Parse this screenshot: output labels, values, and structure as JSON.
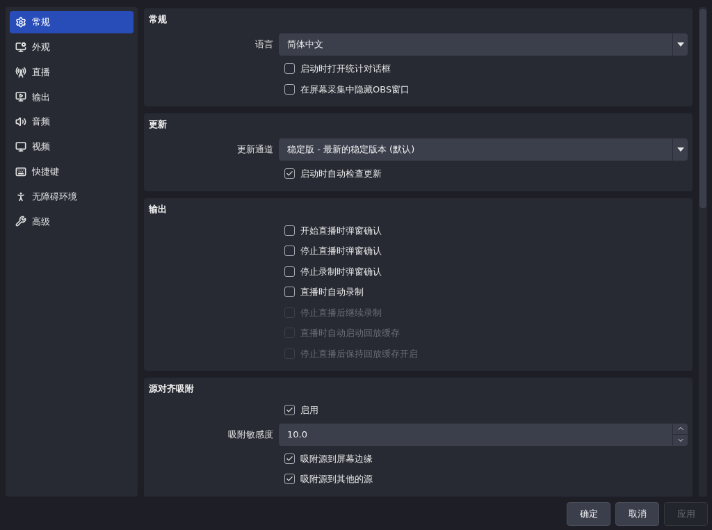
{
  "sidebar": {
    "items": [
      {
        "label": "常规",
        "selected": true
      },
      {
        "label": "外观",
        "selected": false
      },
      {
        "label": "直播",
        "selected": false
      },
      {
        "label": "输出",
        "selected": false
      },
      {
        "label": "音频",
        "selected": false
      },
      {
        "label": "视频",
        "selected": false
      },
      {
        "label": "快捷键",
        "selected": false
      },
      {
        "label": "无障碍环境",
        "selected": false
      },
      {
        "label": "高级",
        "selected": false
      }
    ]
  },
  "sections": [
    {
      "title": "常规",
      "rows": [
        {
          "kind": "select",
          "label": "语言",
          "value": "简体中文"
        },
        {
          "kind": "checkbox",
          "label": "启动时打开统计对话框",
          "checked": false,
          "disabled": false
        },
        {
          "kind": "checkbox",
          "label": "在屏幕采集中隐藏OBS窗口",
          "checked": false,
          "disabled": false
        }
      ]
    },
    {
      "title": "更新",
      "rows": [
        {
          "kind": "select",
          "label": "更新通道",
          "value": "稳定版 - 最新的稳定版本 (默认)"
        },
        {
          "kind": "checkbox",
          "label": "启动时自动检查更新",
          "checked": true,
          "disabled": false
        }
      ]
    },
    {
      "title": "输出",
      "rows": [
        {
          "kind": "checkbox",
          "label": "开始直播时弹窗确认",
          "checked": false,
          "disabled": false
        },
        {
          "kind": "checkbox",
          "label": "停止直播时弹窗确认",
          "checked": false,
          "disabled": false
        },
        {
          "kind": "checkbox",
          "label": "停止录制时弹窗确认",
          "checked": false,
          "disabled": false
        },
        {
          "kind": "checkbox",
          "label": "直播时自动录制",
          "checked": false,
          "disabled": false
        },
        {
          "kind": "checkbox",
          "label": "停止直播后继续录制",
          "checked": false,
          "disabled": true
        },
        {
          "kind": "checkbox",
          "label": "直播时自动启动回放缓存",
          "checked": false,
          "disabled": true
        },
        {
          "kind": "checkbox",
          "label": "停止直播后保持回放缓存开启",
          "checked": false,
          "disabled": true
        }
      ]
    },
    {
      "title": "源对齐吸附",
      "rows": [
        {
          "kind": "checkbox",
          "label": "启用",
          "checked": true,
          "disabled": false
        },
        {
          "kind": "spin",
          "label": "吸附敏感度",
          "value": "10.0"
        },
        {
          "kind": "checkbox",
          "label": "吸附源到屏幕边缘",
          "checked": true,
          "disabled": false
        },
        {
          "kind": "checkbox",
          "label": "吸附源到其他的源",
          "checked": true,
          "disabled": false
        }
      ]
    }
  ],
  "buttons": [
    {
      "label": "确定",
      "disabled": false
    },
    {
      "label": "取消",
      "disabled": false
    },
    {
      "label": "应用",
      "disabled": true
    }
  ]
}
